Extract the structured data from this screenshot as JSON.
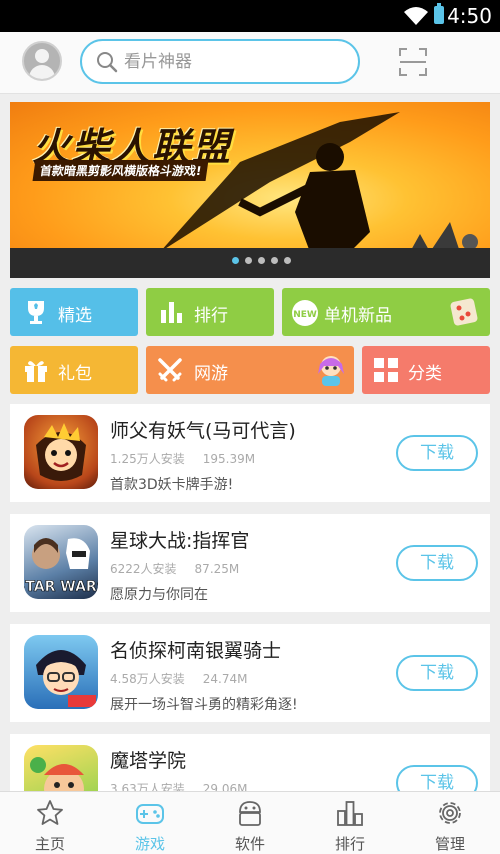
{
  "status_bar": {
    "time": "4:50"
  },
  "header": {
    "search_placeholder": "看片神器",
    "icons": {
      "avatar": "user-avatar",
      "search": "search-icon",
      "scan": "scan-icon"
    }
  },
  "banner": {
    "title": "火柴人联盟",
    "subtitle": "首款暗黑剪影风横版格斗游戏!",
    "page_count": 5,
    "active_page": 0
  },
  "categories": [
    {
      "label": "精选",
      "color": "#55bfe8",
      "icon": "trophy-icon"
    },
    {
      "label": "排行",
      "color": "#8fcd44",
      "icon": "bar-chart-icon"
    },
    {
      "label": "单机新品",
      "color": "#8fcd44",
      "icon": "new-badge-icon"
    },
    {
      "label": "礼包",
      "color": "#f5b734",
      "icon": "gift-icon"
    },
    {
      "label": "网游",
      "color": "#f58f4c",
      "icon": "crossed-swords-icon"
    },
    {
      "label": "分类",
      "color": "#f57b6b",
      "icon": "grid-icon"
    }
  ],
  "apps": [
    {
      "name": "师父有妖气(马可代言)",
      "installs": "1.25万人安装",
      "size": "195.39M",
      "desc": "首款3D妖卡牌手游!",
      "button": "下载"
    },
    {
      "name": "星球大战:指挥官",
      "installs": "6222人安装",
      "size": "87.25M",
      "desc": "愿原力与你同在",
      "button": "下载"
    },
    {
      "name": "名侦探柯南银翼骑士",
      "installs": "4.58万人安装",
      "size": "24.74M",
      "desc": "展开一场斗智斗勇的精彩角逐!",
      "button": "下载"
    },
    {
      "name": "魔塔学院",
      "installs": "3.63万人安装",
      "size": "29.06M",
      "desc": "",
      "button": "下载"
    }
  ],
  "bottom_nav": [
    {
      "label": "主页",
      "icon": "star-icon",
      "active": false
    },
    {
      "label": "游戏",
      "icon": "gamepad-icon",
      "active": true
    },
    {
      "label": "软件",
      "icon": "android-icon",
      "active": false
    },
    {
      "label": "排行",
      "icon": "ranking-icon",
      "active": false
    },
    {
      "label": "管理",
      "icon": "settings-gear-icon",
      "active": false
    }
  ],
  "colors": {
    "accent": "#5bc4e8",
    "background": "#eeeeee"
  }
}
